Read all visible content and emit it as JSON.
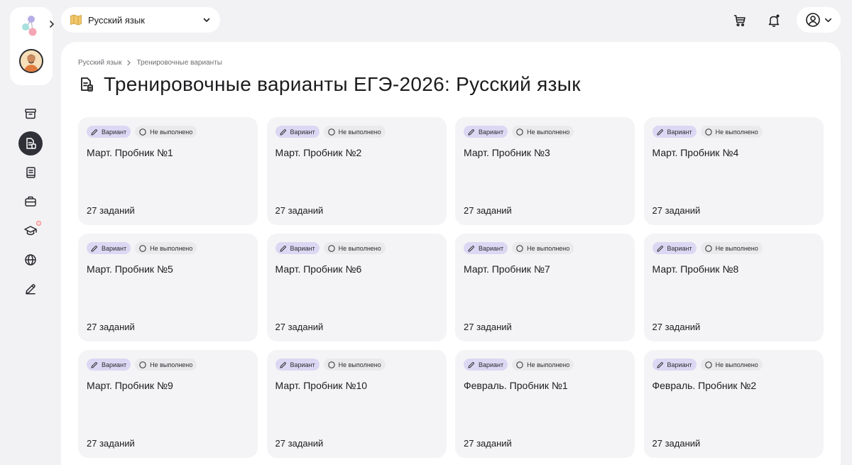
{
  "header": {
    "subject": "Русский язык"
  },
  "breadcrumb": {
    "items": [
      "Русский язык",
      "Тренировочные варианты"
    ]
  },
  "page": {
    "title": "Тренировочные варианты ЕГЭ-2026: Русский язык"
  },
  "cards": [
    {
      "tag": "Вариант",
      "status": "Не выполнено",
      "title": "Март. Пробник №1",
      "count": "27 заданий"
    },
    {
      "tag": "Вариант",
      "status": "Не выполнено",
      "title": "Март. Пробник №2",
      "count": "27 заданий"
    },
    {
      "tag": "Вариант",
      "status": "Не выполнено",
      "title": "Март. Пробник №3",
      "count": "27 заданий"
    },
    {
      "tag": "Вариант",
      "status": "Не выполнено",
      "title": "Март. Пробник №4",
      "count": "27 заданий"
    },
    {
      "tag": "Вариант",
      "status": "Не выполнено",
      "title": "Март. Пробник №5",
      "count": "27 заданий"
    },
    {
      "tag": "Вариант",
      "status": "Не выполнено",
      "title": "Март. Пробник №6",
      "count": "27 заданий"
    },
    {
      "tag": "Вариант",
      "status": "Не выполнено",
      "title": "Март. Пробник №7",
      "count": "27 заданий"
    },
    {
      "tag": "Вариант",
      "status": "Не выполнено",
      "title": "Март. Пробник №8",
      "count": "27 заданий"
    },
    {
      "tag": "Вариант",
      "status": "Не выполнено",
      "title": "Март. Пробник №9",
      "count": "27 заданий"
    },
    {
      "tag": "Вариант",
      "status": "Не выполнено",
      "title": "Март. Пробник №10",
      "count": "27 заданий"
    },
    {
      "tag": "Вариант",
      "status": "Не выполнено",
      "title": "Февраль. Пробник №1",
      "count": "27 заданий"
    },
    {
      "tag": "Вариант",
      "status": "Не выполнено",
      "title": "Февраль. Пробник №2",
      "count": "27 заданий"
    }
  ],
  "colors": {
    "background": "#f2f2f4",
    "panel": "#ffffff",
    "card": "#f4f4f6",
    "tag_variant": "#dcd7f3",
    "tag_status": "#eaeaec",
    "nav_active": "#2f3038"
  },
  "icons": {
    "sidebar": [
      "archive-icon",
      "document-list-icon",
      "notebook-icon",
      "toolbox-icon",
      "graduation-cap-icon",
      "globe-icon",
      "pencil-icon"
    ],
    "header": [
      "cart-icon",
      "bell-icon",
      "user-circle-icon"
    ]
  }
}
